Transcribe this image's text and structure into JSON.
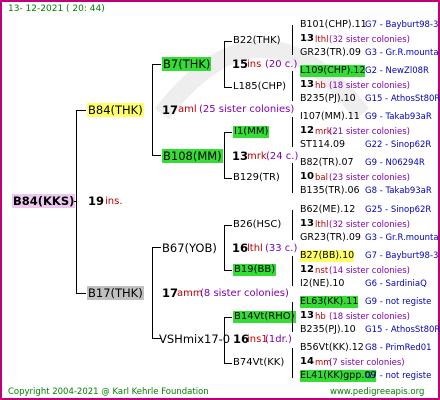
{
  "date": "13- 12-2021 ( 20: 44)",
  "root": {
    "name": "B84(KKS)",
    "year": "19",
    "tag": "ins."
  },
  "gen1": [
    {
      "name": "B84(THK)",
      "year": "17",
      "tag": "aml",
      "note": "(25 sister colonies)"
    },
    {
      "name": "B17(THK)",
      "year": "17",
      "tag": "amm",
      "note": "(8 sister colonies)"
    }
  ],
  "gen2": [
    {
      "name": "B7(THK)",
      "year": "15",
      "tag": "ins",
      "note": "(20 c.)"
    },
    {
      "name": "B108(MM)",
      "year": "13",
      "tag": "mrk",
      "note": "(24 c.)"
    },
    {
      "name": "B67(YOB)",
      "year": "16",
      "tag": "lthl",
      "note": "(33 c.)"
    },
    {
      "name": "VSHmix17-0",
      "year": "16",
      "tag": "ins1",
      "note": "(1dr.)"
    }
  ],
  "gen3": [
    {
      "name": "B22(THK)"
    },
    {
      "name": "L185(CHP)"
    },
    {
      "name": "I1(MM)"
    },
    {
      "name": "B129(TR)"
    },
    {
      "name": "B26(HSC)"
    },
    {
      "name": "B19(BB)"
    },
    {
      "name": "B14Vt(RHO)"
    },
    {
      "name": "B74Vt(KK)"
    }
  ],
  "gen4": [
    {
      "row1": "B101(CHP).11",
      "ref1": "G7 - Bayburt98-3",
      "year": "13",
      "tag": "lthl",
      "note": "(32 sister colonies)",
      "row3": "GR23(TR).09",
      "ref3": "G3 - Gr.R.mounta"
    },
    {
      "row1": "L109(CHP).12",
      "ref1": "G2 - NewZl08R",
      "year": "13",
      "tag": "hb",
      "note": "(18 sister colonies)",
      "row3": "B235(PJ).10",
      "ref3": "G15 - AthosSt80R"
    },
    {
      "row1": "I107(MM).11",
      "ref1": "G9 - Takab93aR",
      "year": "12",
      "tag": "mrk",
      "note": "(21 sister colonies)",
      "row3": "ST114.09",
      "ref3": "G22 - Sinop62R"
    },
    {
      "row1": "B82(TR).07",
      "ref1": "G9 - N06294R",
      "year": "10",
      "tag": "bal",
      "note": "(23 sister colonies)",
      "row3": "B135(TR).06",
      "ref3": "G8 - Takab93aR"
    },
    {
      "row1": "B62(ME).12",
      "ref1": "G25 - Sinop62R",
      "year": "13",
      "tag": "lthl",
      "note": "(32 sister colonies)",
      "row3": "GR23(TR).09",
      "ref3": "G3 - Gr.R.mounta"
    },
    {
      "row1": "B27(BB).10",
      "ref1": "G7 - Bayburt98-3",
      "year": "12",
      "tag": "nst",
      "note": "(14 sister colonies)",
      "row3": "I2(NE).10",
      "ref3": "G6 - SardiniaQ"
    },
    {
      "row1": "EL63(KK).11",
      "ref1": "G9 - not registe",
      "year": "13",
      "tag": "hb",
      "note": "(18 sister colonies)",
      "row3": "B235(PJ).10",
      "ref3": "G15 - AthosSt80R"
    },
    {
      "row1": "B56Vt(KK).12",
      "ref1": "G8 - PrimRed01",
      "year": "14",
      "tag": "mm",
      "note": "(7 sister colonies)",
      "row3": "EL41(KK)gpp.09",
      "ref3": "G7 - not registe"
    }
  ],
  "footer": {
    "copyright": "Copyright 2004-2021 @ Karl Kehrle Foundation",
    "url": "www.pedigreeapis.org"
  },
  "colors": {
    "border": "#c0007a",
    "yellow": "#ffff66",
    "green": "#33dd33",
    "lilac": "#ecc8f0",
    "grey": "#c0c0c0"
  }
}
